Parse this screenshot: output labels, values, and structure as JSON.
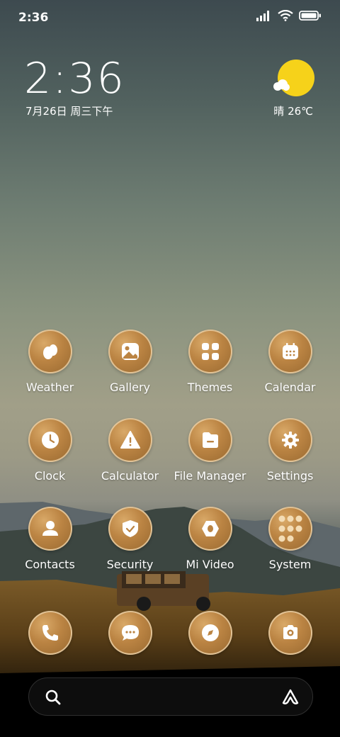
{
  "status_bar": {
    "time": "2:36"
  },
  "clock_widget": {
    "time": "2:36",
    "date": "7月26日 周三下午"
  },
  "weather_widget": {
    "text": "晴 26℃"
  },
  "apps": [
    {
      "label": "Weather",
      "icon": "weather-icon"
    },
    {
      "label": "Gallery",
      "icon": "gallery-icon"
    },
    {
      "label": "Themes",
      "icon": "themes-icon"
    },
    {
      "label": "Calendar",
      "icon": "calendar-icon"
    },
    {
      "label": "Clock",
      "icon": "clock-icon"
    },
    {
      "label": "Calculator",
      "icon": "calculator-icon"
    },
    {
      "label": "File Manager",
      "icon": "file-manager-icon"
    },
    {
      "label": "Settings",
      "icon": "settings-icon"
    },
    {
      "label": "Contacts",
      "icon": "contacts-icon"
    },
    {
      "label": "Security",
      "icon": "security-icon"
    },
    {
      "label": "Mi Video",
      "icon": "mi-video-icon"
    },
    {
      "label": "System",
      "icon": "folder-icon"
    }
  ],
  "dock": [
    {
      "icon": "phone-icon"
    },
    {
      "icon": "messages-icon"
    },
    {
      "icon": "browser-icon"
    },
    {
      "icon": "camera-icon"
    }
  ],
  "search": {
    "icon": "search-icon",
    "assistant_icon": "assistant-icon"
  },
  "colors": {
    "app_icon": "#bb8443",
    "sun": "#f6d21a",
    "search_bar": "#0d0d0d"
  }
}
